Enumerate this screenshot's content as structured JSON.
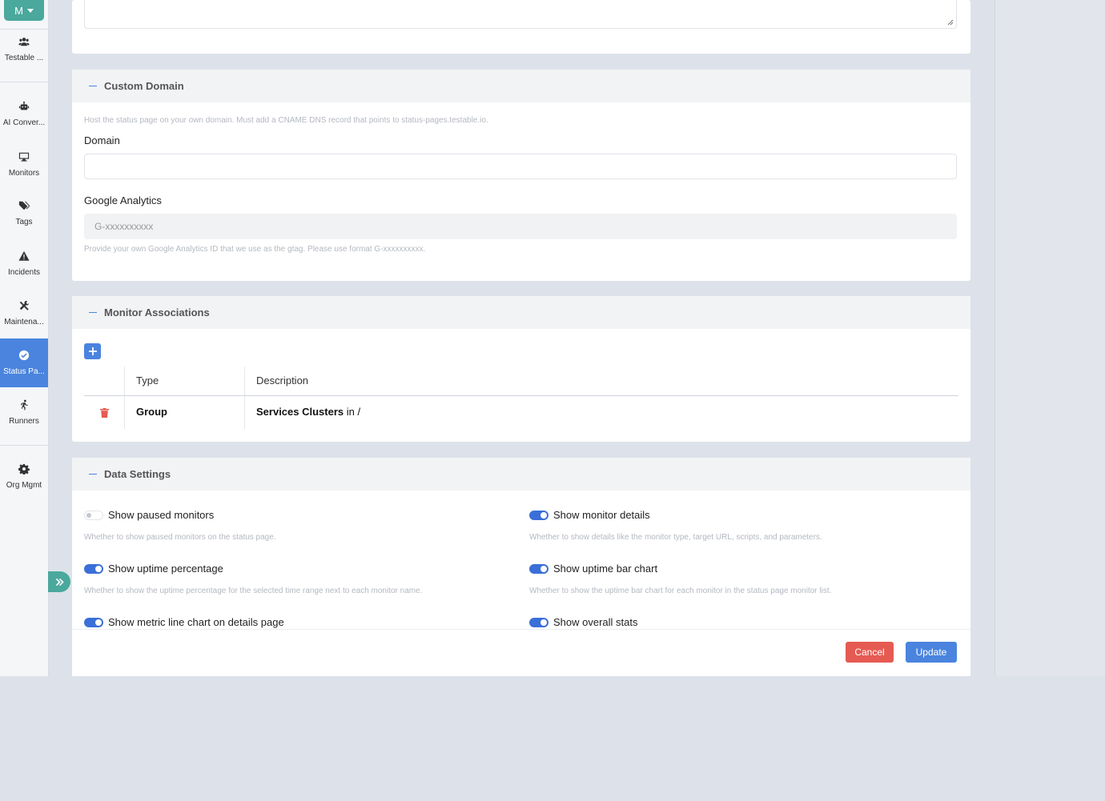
{
  "sidebar": {
    "org_label": "M",
    "items": [
      {
        "label": "Testable ...",
        "icon": "users-icon"
      },
      {
        "label": "AI Conver...",
        "icon": "robot-icon"
      },
      {
        "label": "Monitors",
        "icon": "desktop-icon"
      },
      {
        "label": "Tags",
        "icon": "tags-icon"
      },
      {
        "label": "Incidents",
        "icon": "warning-icon"
      },
      {
        "label": "Maintena...",
        "icon": "tools-icon"
      },
      {
        "label": "Status Pa...",
        "icon": "check-circle-icon",
        "active": true
      },
      {
        "label": "Runners",
        "icon": "runner-icon"
      },
      {
        "label": "Org Mgmt",
        "icon": "gear-icon"
      }
    ]
  },
  "custom_domain": {
    "title": "Custom Domain",
    "hint": "Host the status page on your own domain. Must add a CNAME DNS record that points to status-pages.testable.io.",
    "domain_label": "Domain",
    "domain_value": "",
    "ga_label": "Google Analytics",
    "ga_placeholder": "G-xxxxxxxxxx",
    "ga_hint": "Provide your own Google Analytics ID that we use as the gtag. Please use format G-xxxxxxxxxx."
  },
  "monitor_associations": {
    "title": "Monitor Associations",
    "columns": [
      "Type",
      "Description"
    ],
    "rows": [
      {
        "type": "Group",
        "desc_bold": "Services Clusters",
        "desc_rest": " in /"
      }
    ]
  },
  "data_settings": {
    "title": "Data Settings",
    "toggles": [
      {
        "label": "Show paused monitors",
        "desc": "Whether to show paused monitors on the status page.",
        "on": false
      },
      {
        "label": "Show monitor details",
        "desc": "Whether to show details like the monitor type, target URL, scripts, and parameters.",
        "on": true
      },
      {
        "label": "Show uptime percentage",
        "desc": "Whether to show the uptime percentage for the selected time range next to each monitor name.",
        "on": true
      },
      {
        "label": "Show uptime bar chart",
        "desc": "Whether to show the uptime bar chart for each monitor in the status page monitor list.",
        "on": true
      },
      {
        "label": "Show metric line chart on details page",
        "desc": "",
        "on": true
      },
      {
        "label": "Show overall stats",
        "desc": "",
        "on": true
      }
    ]
  },
  "footer": {
    "cancel": "Cancel",
    "update": "Update"
  },
  "colors": {
    "accent": "#4a84de",
    "teal": "#4aa89c",
    "danger": "#e55b52"
  }
}
